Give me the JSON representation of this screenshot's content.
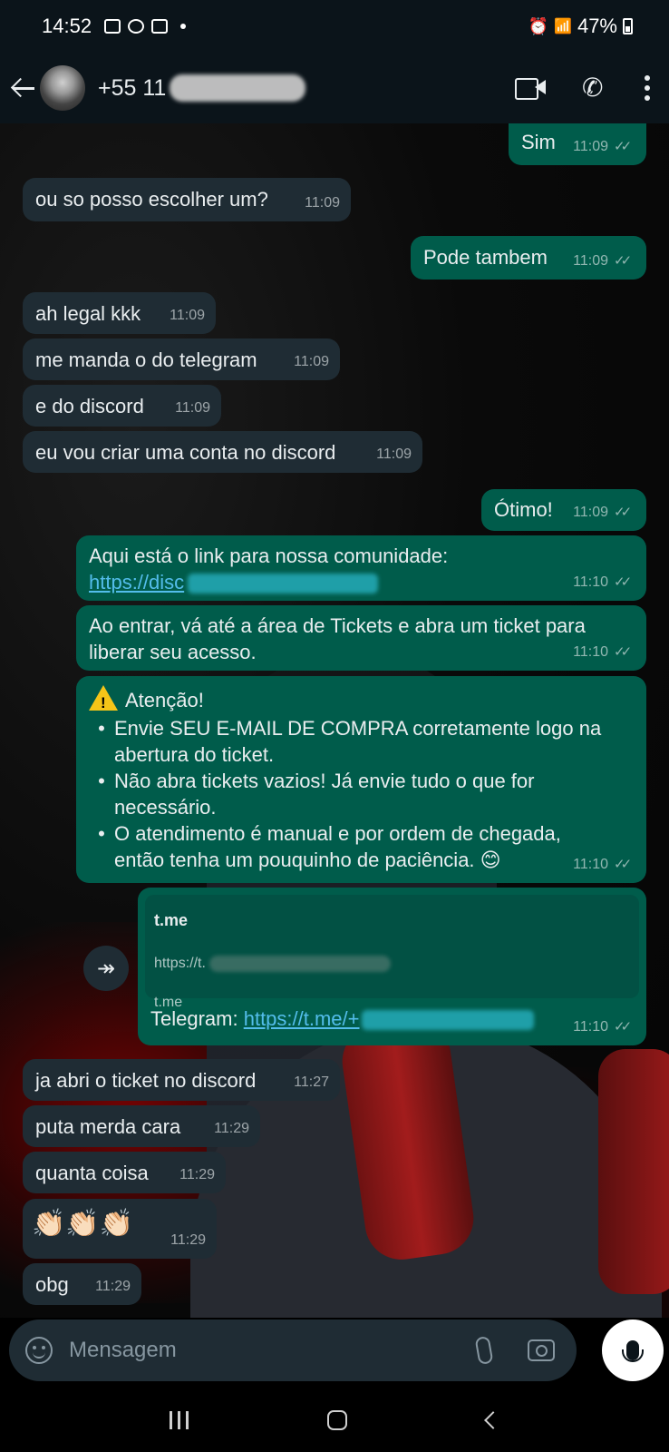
{
  "status_bar": {
    "time": "14:52",
    "battery": "47%"
  },
  "header": {
    "contact_prefix": "+55 11"
  },
  "messages": {
    "m1": {
      "text": "Sim",
      "time": "11:09"
    },
    "m2": {
      "text": "ou so posso escolher um?",
      "time": "11:09"
    },
    "m3": {
      "text": "Pode tambem",
      "time": "11:09"
    },
    "m4": {
      "text": "ah legal kkk",
      "time": "11:09"
    },
    "m5": {
      "text": "me manda o do telegram",
      "time": "11:09"
    },
    "m6": {
      "text": "e do discord",
      "time": "11:09"
    },
    "m7": {
      "text": "eu vou criar uma conta no discord",
      "time": "11:09"
    },
    "m8": {
      "text": "Ótimo!",
      "time": "11:09"
    },
    "m9": {
      "text": "Aqui está o link para nossa comunidade:",
      "link": "https://disc",
      "time": "11:10"
    },
    "m10": {
      "text": "Ao entrar, vá até a área de Tickets e abra um ticket para liberar seu acesso.",
      "time": "11:10"
    },
    "m11": {
      "title": "Atenção!",
      "items": [
        "Envie SEU E-MAIL DE COMPRA corretamente logo na abertura do ticket.",
        "Não abra tickets vazios! Já envie tudo o que for necessário.",
        "O atendimento é manual e por ordem de chegada, então tenha um pouquinho de paciência. 😊"
      ],
      "time": "11:10"
    },
    "m12": {
      "preview_title": "t.me",
      "preview_url": "https://t.",
      "preview_host": "t.me",
      "label": "Telegram: ",
      "link": "https://t.me/+",
      "time": "11:10"
    },
    "m13": {
      "text": "ja abri o ticket no discord",
      "time": "11:27"
    },
    "m14": {
      "text": "puta merda cara",
      "time": "11:29"
    },
    "m15": {
      "text": "quanta coisa",
      "time": "11:29"
    },
    "m16": {
      "text": "👏🏻👏🏻👏🏻",
      "time": "11:29"
    },
    "m17": {
      "text": "obg",
      "time": "11:29"
    }
  },
  "composer": {
    "placeholder": "Mensagem"
  },
  "icons": {
    "back": "arrow-left-icon",
    "video": "video-call-icon",
    "phone": "phone-icon",
    "more": "more-vert-icon",
    "emoji": "emoji-icon",
    "attach": "paperclip-icon",
    "camera": "camera-icon",
    "mic": "mic-icon",
    "forward": "forward-icon",
    "warning": "warning-icon"
  },
  "colors": {
    "incoming_bubble": "#1f2c34",
    "outgoing_bubble": "#005c4b",
    "link": "#53bdeb",
    "header_bg": "#0b141a"
  }
}
